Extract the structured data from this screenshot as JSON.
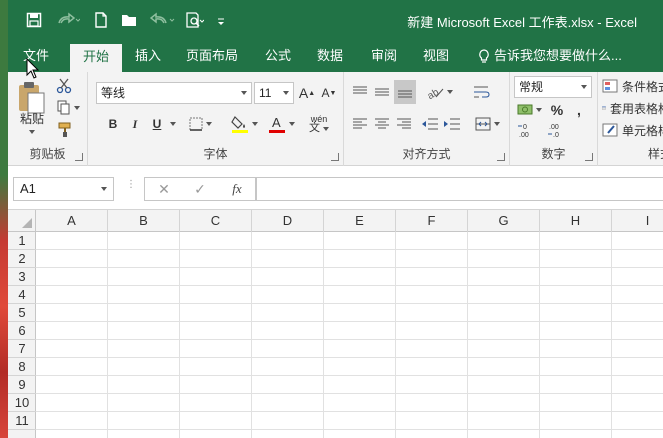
{
  "window": {
    "title": "新建 Microsoft Excel 工作表.xlsx - Excel"
  },
  "qat": {
    "icons": [
      "save-icon",
      "redo-icon",
      "new-file-icon",
      "open-folder-icon",
      "undo-icon",
      "print-preview-icon",
      "customize-qat-icon"
    ]
  },
  "tabs": [
    {
      "label": "文件"
    },
    {
      "label": "开始"
    },
    {
      "label": "插入"
    },
    {
      "label": "页面布局"
    },
    {
      "label": "公式"
    },
    {
      "label": "数据"
    },
    {
      "label": "审阅"
    },
    {
      "label": "视图"
    }
  ],
  "tellme": {
    "label": "告诉我您想要做什么..."
  },
  "ribbon": {
    "clipboard": {
      "label": "剪贴板",
      "paste_label": "粘贴"
    },
    "font": {
      "label": "字体",
      "font_name": "等线",
      "font_size": "11",
      "bold": "B",
      "italic": "I",
      "underline": "U",
      "phonetic": "wén"
    },
    "alignment": {
      "label": "对齐方式"
    },
    "number": {
      "label": "数字",
      "format": "常规",
      "percent": "%"
    },
    "styles": {
      "label": "样式",
      "conditional_format": "条件格式",
      "table_format": "套用表格格式",
      "cell_styles": "单元格样式"
    }
  },
  "formula_bar": {
    "name_box": "A1",
    "fx": "fx",
    "value": ""
  },
  "columns": [
    "A",
    "B",
    "C",
    "D",
    "E",
    "F",
    "G",
    "H",
    "I"
  ],
  "rows": [
    "1",
    "2",
    "3",
    "4",
    "5",
    "6",
    "7",
    "8",
    "9",
    "10",
    "11"
  ],
  "colors": {
    "accent": "#217346",
    "ribbon_bg": "#f3f3f3",
    "font_color_bar": "#e00000",
    "highlight_bar": "#ffff00"
  }
}
